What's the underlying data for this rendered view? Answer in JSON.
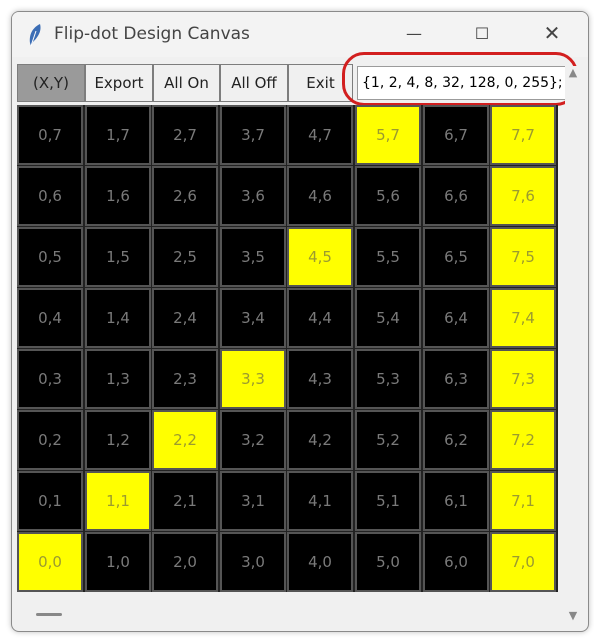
{
  "window": {
    "title": "Flip-dot Design Canvas"
  },
  "controls": {
    "minimize": "—",
    "maximize": "☐",
    "close": "✕"
  },
  "toolbar": {
    "coord_label": "(X,Y)",
    "export_label": "Export",
    "all_on_label": "All On",
    "all_off_label": "All Off",
    "exit_label": "Exit"
  },
  "output": {
    "value": "{1, 2, 4, 8, 32, 128, 0, 255};"
  },
  "grid": {
    "rows": [
      [
        {
          "label": "0,7",
          "on": false
        },
        {
          "label": "1,7",
          "on": false
        },
        {
          "label": "2,7",
          "on": false
        },
        {
          "label": "3,7",
          "on": false
        },
        {
          "label": "4,7",
          "on": false
        },
        {
          "label": "5,7",
          "on": true
        },
        {
          "label": "6,7",
          "on": false
        },
        {
          "label": "7,7",
          "on": true
        }
      ],
      [
        {
          "label": "0,6",
          "on": false
        },
        {
          "label": "1,6",
          "on": false
        },
        {
          "label": "2,6",
          "on": false
        },
        {
          "label": "3,6",
          "on": false
        },
        {
          "label": "4,6",
          "on": false
        },
        {
          "label": "5,6",
          "on": false
        },
        {
          "label": "6,6",
          "on": false
        },
        {
          "label": "7,6",
          "on": true
        }
      ],
      [
        {
          "label": "0,5",
          "on": false
        },
        {
          "label": "1,5",
          "on": false
        },
        {
          "label": "2,5",
          "on": false
        },
        {
          "label": "3,5",
          "on": false
        },
        {
          "label": "4,5",
          "on": true
        },
        {
          "label": "5,5",
          "on": false
        },
        {
          "label": "6,5",
          "on": false
        },
        {
          "label": "7,5",
          "on": true
        }
      ],
      [
        {
          "label": "0,4",
          "on": false
        },
        {
          "label": "1,4",
          "on": false
        },
        {
          "label": "2,4",
          "on": false
        },
        {
          "label": "3,4",
          "on": false
        },
        {
          "label": "4,4",
          "on": false
        },
        {
          "label": "5,4",
          "on": false
        },
        {
          "label": "6,4",
          "on": false
        },
        {
          "label": "7,4",
          "on": true
        }
      ],
      [
        {
          "label": "0,3",
          "on": false
        },
        {
          "label": "1,3",
          "on": false
        },
        {
          "label": "2,3",
          "on": false
        },
        {
          "label": "3,3",
          "on": true
        },
        {
          "label": "4,3",
          "on": false
        },
        {
          "label": "5,3",
          "on": false
        },
        {
          "label": "6,3",
          "on": false
        },
        {
          "label": "7,3",
          "on": true
        }
      ],
      [
        {
          "label": "0,2",
          "on": false
        },
        {
          "label": "1,2",
          "on": false
        },
        {
          "label": "2,2",
          "on": true
        },
        {
          "label": "3,2",
          "on": false
        },
        {
          "label": "4,2",
          "on": false
        },
        {
          "label": "5,2",
          "on": false
        },
        {
          "label": "6,2",
          "on": false
        },
        {
          "label": "7,2",
          "on": true
        }
      ],
      [
        {
          "label": "0,1",
          "on": false
        },
        {
          "label": "1,1",
          "on": true
        },
        {
          "label": "2,1",
          "on": false
        },
        {
          "label": "3,1",
          "on": false
        },
        {
          "label": "4,1",
          "on": false
        },
        {
          "label": "5,1",
          "on": false
        },
        {
          "label": "6,1",
          "on": false
        },
        {
          "label": "7,1",
          "on": true
        }
      ],
      [
        {
          "label": "0,0",
          "on": true
        },
        {
          "label": "1,0",
          "on": false
        },
        {
          "label": "2,0",
          "on": false
        },
        {
          "label": "3,0",
          "on": false
        },
        {
          "label": "4,0",
          "on": false
        },
        {
          "label": "5,0",
          "on": false
        },
        {
          "label": "6,0",
          "on": false
        },
        {
          "label": "7,0",
          "on": true
        }
      ]
    ]
  },
  "colors": {
    "on": "#ffff00",
    "off": "#000000",
    "highlight_ring": "#d21f1f"
  }
}
